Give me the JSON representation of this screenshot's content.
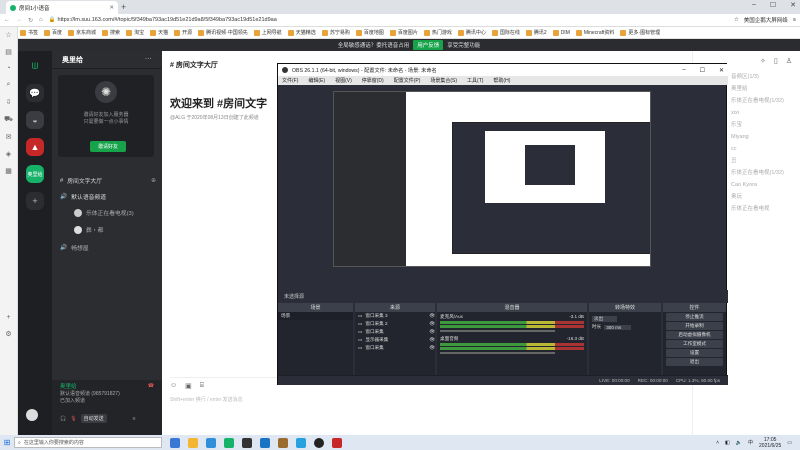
{
  "browser": {
    "tab_title": "房间1小语音",
    "url": "https://lm.suu.163.com/#/topic/5f349ba793ac19d51e21d9a8/5f349ba793ac19d51e21d9aa",
    "right_status": "美国企鹅大屏网络",
    "bookmarks": [
      "书签",
      "百度",
      "京东商城",
      "搜索",
      "淘宝",
      "天猫",
      "开源",
      "腾讯视频·中国领先",
      "上网导航",
      "天猫精选",
      "苏宁易购",
      "百度地图",
      "百度图片",
      "热门游戏",
      "腾讯中心",
      "国际在线",
      "腾讯2",
      "DIM",
      "Minecraft资料",
      "更多·图标管理"
    ],
    "notice_text": "全局敏感通话？委托语音占用",
    "notice_btn": "用户反馈",
    "notice_suffix": "享受完整功能"
  },
  "server": {
    "name": "奥里给",
    "invite_line1": "邀请好友加入服务器",
    "invite_line2": "只需要做一点小事情",
    "invite_button": "邀请好友",
    "channels": [
      {
        "name": "房间文字大厅",
        "type": "text"
      },
      {
        "name": "默认语音频道",
        "type": "voice"
      }
    ],
    "voice_members": [
      "乐体正在看电视(3)",
      "彝・都"
    ],
    "other_channel": "畅想屋",
    "user": {
      "name": "奥里给",
      "status_line1": "默认语音频道 (985791827)",
      "status_line2": "已加入频道",
      "live_btn": "自动发送"
    }
  },
  "page": {
    "topic_title": "房间文字大厅",
    "welcome": "欢迎来到 #房间文字",
    "created": "@ALG 于2020年08月13日创建了此频道",
    "composer_hint": "Shift+enter 换行 / enter 发送消息"
  },
  "right_panel": {
    "items": [
      "音频区(1/3)",
      "奥里给",
      "乐体正在看电视(1/32)",
      "xixi",
      "乐宝",
      "Miyang",
      "cc",
      "丑",
      "乐体正在看电视(1/32)",
      "Cao Kyora",
      "奥玩",
      "乐体正在看电视"
    ]
  },
  "obs": {
    "title": "OBS 26.1.1 (64-bit, windows) - 配置文件: 未命名 - 场景: 未命名",
    "menu": [
      "文件(F)",
      "编辑(E)",
      "视图(V)",
      "停靠窗(D)",
      "配置文件(P)",
      "场景集合(S)",
      "工具(T)",
      "帮助(H)"
    ],
    "preview_label": "未选择源",
    "docks": {
      "scenes": {
        "title": "场景",
        "items": [
          "场景"
        ]
      },
      "sources": {
        "title": "来源",
        "items": [
          "窗口采集 3",
          "窗口采集 2",
          "窗口采集",
          "显示器采集",
          "窗口采集"
        ]
      },
      "mixer": {
        "title": "混音器",
        "tracks": [
          {
            "name": "麦克风/Aux",
            "db": "-3.1 dB"
          },
          {
            "name": "桌面音频",
            "db": "-16.3 dB"
          }
        ]
      },
      "transitions": {
        "title": "转场特效",
        "type": "淡出",
        "duration_label": "时长",
        "duration": "300 ms"
      },
      "controls": {
        "title": "控件",
        "buttons": [
          "停止推流",
          "开始录制",
          "启动虚拟摄像机",
          "工作室模式",
          "设置",
          "退出"
        ]
      }
    },
    "status": {
      "live": "LIVE: 00:00:00",
      "rec": "REC: 00:00:00",
      "cpu": "CPU: 1.3%, 60.00 fps"
    }
  },
  "taskbar": {
    "search_placeholder": "在这里输入你要搜索的内容",
    "time": "17:05",
    "date": "2021/6/25",
    "lang": "中"
  },
  "colors": {
    "accent_green": "#16a34a",
    "dark_bg": "#2b2d31",
    "obs_bg": "#2b2e38"
  }
}
